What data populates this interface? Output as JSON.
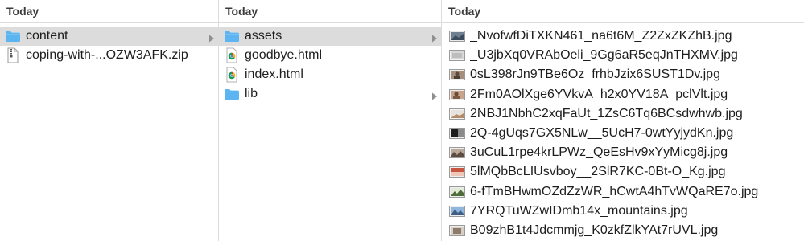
{
  "columns": [
    {
      "header": "Today",
      "items": [
        {
          "label": "content",
          "icon": "folder-icon",
          "selected": true,
          "has_children": true
        },
        {
          "label": "coping-with-...OZW3AFK.zip",
          "icon": "zip-file-icon",
          "selected": false,
          "has_children": false
        }
      ]
    },
    {
      "header": "Today",
      "items": [
        {
          "label": "assets",
          "icon": "folder-icon",
          "selected": true,
          "has_children": true
        },
        {
          "label": "goodbye.html",
          "icon": "chrome-html-icon",
          "selected": false,
          "has_children": false
        },
        {
          "label": "index.html",
          "icon": "chrome-html-icon",
          "selected": false,
          "has_children": false
        },
        {
          "label": "lib",
          "icon": "folder-icon",
          "selected": false,
          "has_children": true
        }
      ]
    },
    {
      "header": "Today",
      "items": [
        {
          "label": "_NvofwfDiTXKN461_na6t6M_Z2ZxZKZhB.jpg",
          "icon": "image-thumbnail-icon"
        },
        {
          "label": "_U3jbXq0VRAbOeli_9Gg6aR5eqJnTHXMV.jpg",
          "icon": "image-thumbnail-icon"
        },
        {
          "label": "0sL398rJn9TBe6Oz_frhbJzix6SUST1Dv.jpg",
          "icon": "image-thumbnail-icon"
        },
        {
          "label": "2Fm0AOlXge6YVkvA_h2x0YV18A_pclVlt.jpg",
          "icon": "image-thumbnail-icon"
        },
        {
          "label": "2NBJ1NbhC2xqFaUt_1ZsC6Tq6BCsdwhwb.jpg",
          "icon": "image-thumbnail-icon"
        },
        {
          "label": "2Q-4gUqs7GX5NLw__5UcH7-0wtYyjydKn.jpg",
          "icon": "image-thumbnail-icon"
        },
        {
          "label": "3uCuL1rpe4krLPWz_QeEsHv9xYyMicg8j.jpg",
          "icon": "image-thumbnail-icon"
        },
        {
          "label": "5lMQbBcLIUsvboy__2SlR7KC-0Bt-O_Kg.jpg",
          "icon": "image-thumbnail-icon"
        },
        {
          "label": "6-fTmBHwmOZdZzWR_hCwtA4hTvWQaRE7o.jpg",
          "icon": "image-thumbnail-icon"
        },
        {
          "label": "7YRQTuWZwIDmb14x_mountains.jpg",
          "icon": "image-thumbnail-icon"
        },
        {
          "label": "B09zhB1t4Jdcmmjg_K0zkfZlkYAt7rUVL.jpg",
          "icon": "image-thumbnail-icon"
        }
      ]
    }
  ],
  "colors": {
    "folder": "#5cb5f0",
    "selection": "#dcdcdc",
    "divider": "#dcdcdc",
    "chevron": "#8e8e93"
  }
}
